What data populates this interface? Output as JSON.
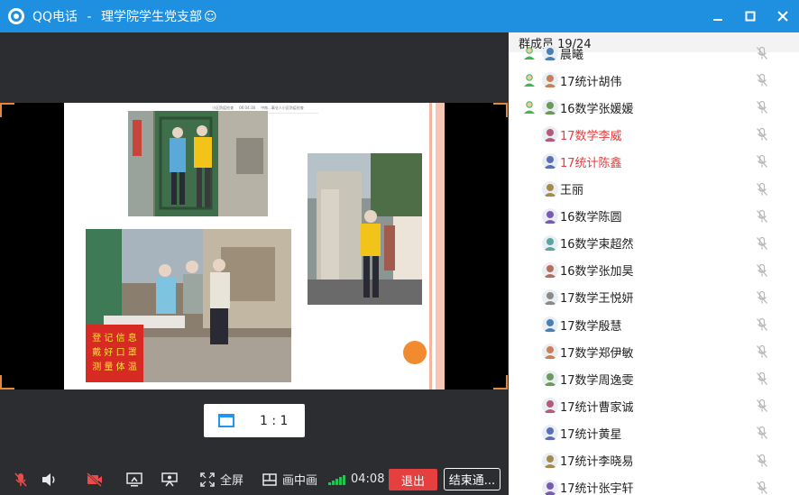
{
  "window": {
    "app_name": "QQ电话",
    "separator": "-",
    "group_name": "理学院学生党支部",
    "title_emoji": "☺"
  },
  "slide": {
    "header_left": "小区防疫检查",
    "header_mid": "06:04:38",
    "header_right": "中南...事业人小区防疫检查",
    "banner_text": [
      "登 记 信 息",
      "戴 好 口 罩",
      "测 量 体 温"
    ]
  },
  "ratio_control": {
    "label": "1 : 1"
  },
  "toolbar": {
    "fullscreen_label": "全屏",
    "pip_label": "画中画",
    "timer": "04:08",
    "exit_label": "退出",
    "end_label": "结束通..."
  },
  "members_panel": {
    "header": "群成员 19/24",
    "members": [
      {
        "name": "晨曦",
        "status": "talk",
        "color": "normal",
        "partial": true
      },
      {
        "name": "17统计胡伟",
        "status": "talk",
        "color": "normal"
      },
      {
        "name": "16数学张媛媛",
        "status": "talk",
        "color": "normal"
      },
      {
        "name": "17数学李威",
        "status": "none",
        "color": "red"
      },
      {
        "name": "17统计陈鑫",
        "status": "none",
        "color": "red"
      },
      {
        "name": "王丽",
        "status": "none",
        "color": "normal"
      },
      {
        "name": "16数学陈圆",
        "status": "none",
        "color": "normal"
      },
      {
        "name": "16数学束超然",
        "status": "none",
        "color": "normal"
      },
      {
        "name": "16数学张加昊",
        "status": "none",
        "color": "normal"
      },
      {
        "name": "17数学王悦妍",
        "status": "none",
        "color": "normal"
      },
      {
        "name": "17数学殷慧",
        "status": "none",
        "color": "normal"
      },
      {
        "name": "17数学郑伊敏",
        "status": "none",
        "color": "normal"
      },
      {
        "name": "17数学周逸雯",
        "status": "none",
        "color": "normal"
      },
      {
        "name": "17统计曹家诚",
        "status": "none",
        "color": "normal"
      },
      {
        "name": "17统计黄星",
        "status": "none",
        "color": "normal"
      },
      {
        "name": "17统计李晓易",
        "status": "none",
        "color": "normal"
      },
      {
        "name": "17统计张宇轩",
        "status": "none",
        "color": "normal"
      }
    ]
  },
  "colors": {
    "titlebar": "#1f8fe0",
    "panel_dark": "#2b2d30",
    "exit_red": "#e63f3f",
    "highlight_red": "#e83a3a",
    "signal_green": "#24c24f",
    "accent_orange": "#f28a30"
  }
}
